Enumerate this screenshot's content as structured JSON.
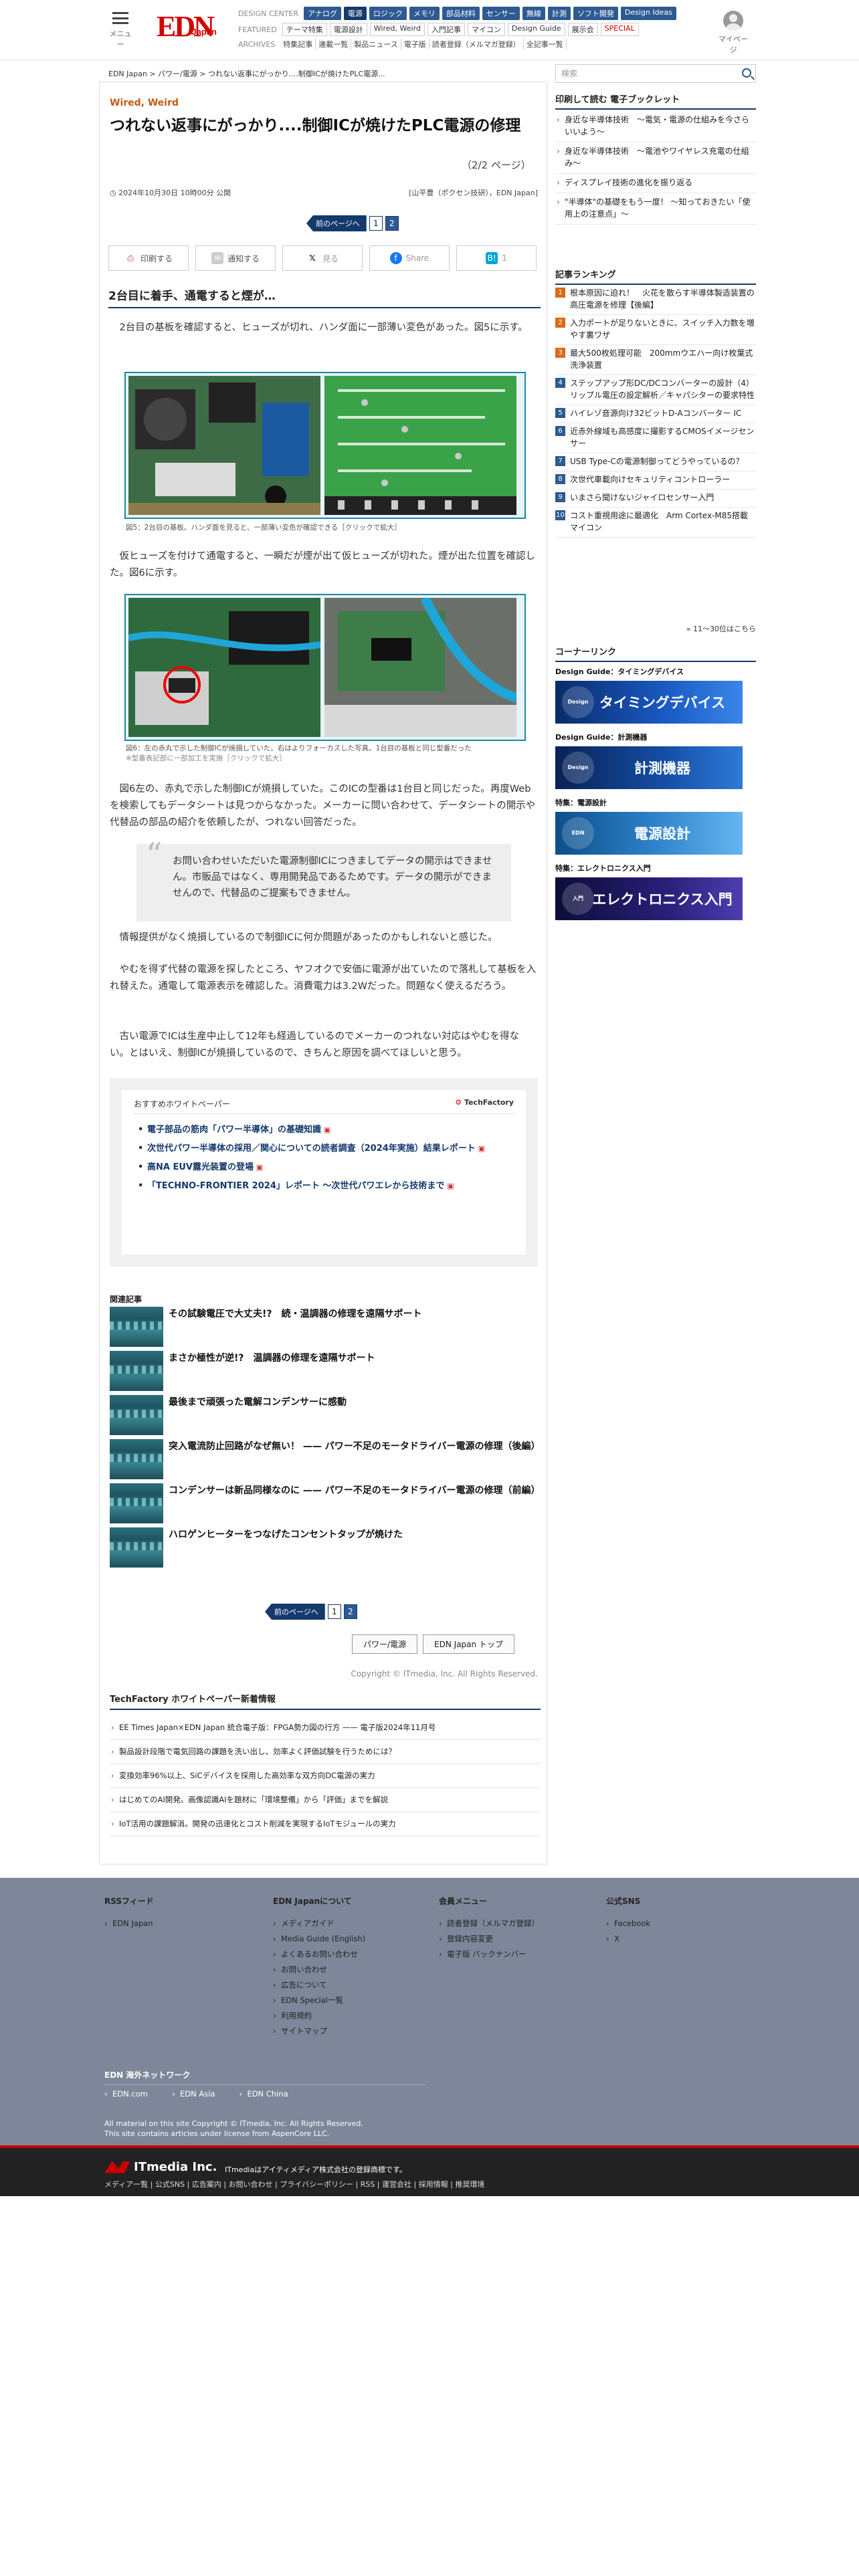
{
  "header": {
    "menu_label": "メニュー",
    "logo": "EDN",
    "logo_sub": "Japan",
    "design_center_label": "DESIGN CENTER",
    "design_center": [
      "アナログ",
      "電源",
      "ロジック",
      "メモリ",
      "部品材料",
      "センサー",
      "無線",
      "計測",
      "ソフト開発",
      "Design Ideas"
    ],
    "design_center_hot": "電源",
    "featured_label": "FEATURED",
    "featured": [
      "テーマ特集",
      "電源設計",
      "Wired, Weird",
      "入門記事",
      "マイコン",
      "Design Guide",
      "展示会",
      "SPECIAL"
    ],
    "archives_label": "ARCHIVES",
    "archives": [
      "特集記事",
      "連載一覧",
      "製品ニュース",
      "電子版",
      "読者登録（メルマガ登録）",
      "全記事一覧"
    ],
    "mypage_label": "マイページ"
  },
  "breadcrumb": "EDN Japan  >  パワー/電源  >  つれない返事にがっかり....制御ICが焼けたPLC電源...",
  "article": {
    "category": "Wired, Weird",
    "title": "つれない返事にがっかり....制御ICが焼けたPLC電源の修理",
    "page_indicator": "（2/2 ページ）",
    "date": "2024年10月30日 10時00分 公開",
    "author": "[山平豊（ポクセン技研），EDN Japan]",
    "pager": {
      "prev": "前のページへ",
      "pages": [
        "1",
        "2"
      ],
      "current": "2"
    },
    "share": {
      "print": "印刷する",
      "notify": "通知する",
      "x": "見る",
      "facebook": "Share",
      "hatena": "1"
    },
    "section_heading": "2台目に着手、通電すると煙が…",
    "p1": "2台目の基板を確認すると、ヒューズが切れ、ハンダ面に一部薄い変色があった。図5に示す。",
    "fig5_caption": "図5：2台目の基板。ハンダ面を見ると、一部薄い変色が確認できる［クリックで拡大］",
    "p2": "仮ヒューズを付けて通電すると、一瞬だが煙が出て仮ヒューズが切れた。煙が出た位置を確認した。図6に示す。",
    "fig6_caption": "図6：左の赤丸で示した制御ICが焼損していた。右はよりフォーカスした写真。1台目の基板と同じ型番だった",
    "fig6_note": "※型番表記部に一部加工を実施［クリックで拡大］",
    "p3": "図6左の、赤丸で示した制御ICが焼損していた。このICの型番は1台目と同じだった。再度Webを検索してもデータシートは見つからなかった。メーカーに問い合わせて、データシートの開示や代替品の部品の紹介を依頼したが、つれない回答だった。",
    "quote": "お問い合わせいただいた電源制御ICにつきましてデータの開示はできません。市販品ではなく、専用開発品であるためです。データの開示ができませんので、代替品のご提案もできません。",
    "p4": "情報提供がなく焼損しているので制御ICに何か問題があったのかもしれないと感じた。",
    "p5": "やむを得ず代替の電源を探したところ、ヤフオクで安価に電源が出ていたので落札して基板を入れ替えた。通電して電源表示を確認した。消費電力は3.2Wだった。問題なく使えるだろう。",
    "p6": "古い電源でICは生産中止して12年も経過しているのでメーカーのつれない対応はやむを得ない。とはいえ、制御ICが焼損しているので、きちんと原因を調べてほしいと思う。"
  },
  "whitepaper": {
    "heading": "おすすめホワイトペーパー",
    "brand": "TechFactory",
    "items": [
      "電子部品の筋肉「パワー半導体」の基礎知識",
      "次世代パワー半導体の採用／関心についての読者調査（2024年実施）結果レポート",
      "高NA EUV露光装置の登場",
      "「TECHNO-FRONTIER 2024」レポート ～次世代パワエレから技術まで"
    ]
  },
  "related": {
    "heading": "関連記事",
    "items": [
      "その試験電圧で大丈夫!?　続・温調器の修理を遠隔サポート",
      "まさか極性が逆!?　温調器の修理を遠隔サポート",
      "最後まで頑張った電解コンデンサーに感動",
      "突入電流防止回路がなぜ無い！ —— パワー不足のモータドライバー電源の修理（後編）",
      "コンデンサーは新品同様なのに —— パワー不足のモータドライバー電源の修理（前編）",
      "ハロゲンヒーターをつなげたコンセントタップが焼けた"
    ]
  },
  "bottom": {
    "btn_power": "パワー/電源",
    "btn_top": "EDN Japan トップ",
    "copyright": "Copyright © ITmedia, Inc. All Rights Reserved.",
    "tf_heading": "TechFactory ホワイトペーパー新着情報",
    "tf_items": [
      "EE Times Japan×EDN Japan 統合電子版：FPGA勢力図の行方 —— 電子版2024年11月号",
      "製品設計段階で電気回路の課題を洗い出し、効率よく評価試験を行うためには？",
      "変換効率96%以上、SiCデバイスを採用した高効率な双方向DC電源の実力",
      "はじめてのAI開発。画像認識AIを題材に「環境整備」から「評価」までを解説",
      "IoT活用の課題解消。開発の迅速化とコスト削減を実現するIoTモジュールの実力"
    ]
  },
  "sidebar": {
    "search_placeholder": "検索",
    "booklet_heading": "印刷して読む 電子ブックレット",
    "booklets": [
      "身近な半導体技術　～電気・電源の仕組みを今さらいいよう～",
      "身近な半導体技術　～電池やワイヤレス充電の仕組み～",
      "ディスプレイ技術の進化を振り返る",
      "\"半導体\"の基礎をもう一度！ ～知っておきたい「使用上の注意点」～"
    ],
    "ranking_heading": "記事ランキング",
    "ranking": [
      "根本原因に迫れ！　火花を散らす半導体製造装置の高圧電源を修理【後編】",
      "入力ポートが足りないときに、スイッチ入力数を増やす裏ワザ",
      "最大500枚処理可能　200mmウエハー向け枚葉式洗浄装置",
      "ステップアップ形DC/DCコンバーターの設計（4）リップル電圧の設定解析／キャパシターの要求特性",
      "ハイレゾ音源向け32ビットD-Aコンバーター IC",
      "近赤外線域も高感度に撮影するCMOSイメージセンサー",
      "USB Type-Cの電源制御ってどうやっているの？",
      "次世代車載向けセキュリティコントローラー",
      "いまさら聞けないジャイロセンサー入門",
      "コスト重視用途に最適化　Arm Cortex-M85搭載マイコン"
    ],
    "ranking_more": "» 11〜30位はこちら",
    "corner_heading": "コーナーリンク",
    "corners": [
      {
        "label": "Design Guide：タイミングデバイス",
        "banner": "タイミングデバイス",
        "eb": "Design Guide"
      },
      {
        "label": "Design Guide：計測機器",
        "banner": "計測機器",
        "eb": "Design Guide"
      },
      {
        "label": "特集：電源設計",
        "banner": "電源設計",
        "eb": "EDN"
      },
      {
        "label": "特集：エレクトロニクス入門",
        "banner": "エレクトロニクス入門",
        "eb": "入門"
      }
    ]
  },
  "footer": {
    "rss": {
      "heading": "RSSフィード",
      "items": [
        "EDN Japan"
      ]
    },
    "about": {
      "heading": "EDN Japanについて",
      "items": [
        "メディアガイド",
        "Media Guide (English)",
        "よくあるお問い合わせ",
        "お問い合わせ",
        "広告について",
        "EDN Special一覧",
        "利用規約",
        "サイトマップ"
      ]
    },
    "member": {
      "heading": "会員メニュー",
      "items": [
        "読者登録（メルマガ登録）",
        "登録内容変更",
        "電子版 バックナンバー"
      ]
    },
    "sns": {
      "heading": "公式SNS",
      "items": [
        "Facebook",
        "X"
      ]
    },
    "overseas_heading": "EDN 海外ネットワーク",
    "overseas": [
      "EDN.com",
      "EDN Asia",
      "EDN China"
    ],
    "copy1": "All material on this site Copyright © ITmedia, Inc. All Rights Reserved.",
    "copy2": "This site contains articles under license from AspenCore LLC.",
    "itmedia": "ITmedia Inc.",
    "itmedia_tag": "ITmediaはアイティメディア株式会社の登録商標です。",
    "itmedia_links": "メディア一覧 | 公式SNS | 広告案内 | お問い合わせ | プライバシーポリシー | RSS | 運営会社 | 採用情報 | 推奨環境"
  },
  "colors": {
    "navy": "#14396d",
    "blue": "#2d5a92",
    "orange": "#c55a11",
    "teal": "#1a8aa0",
    "footer": "#7d8799"
  }
}
